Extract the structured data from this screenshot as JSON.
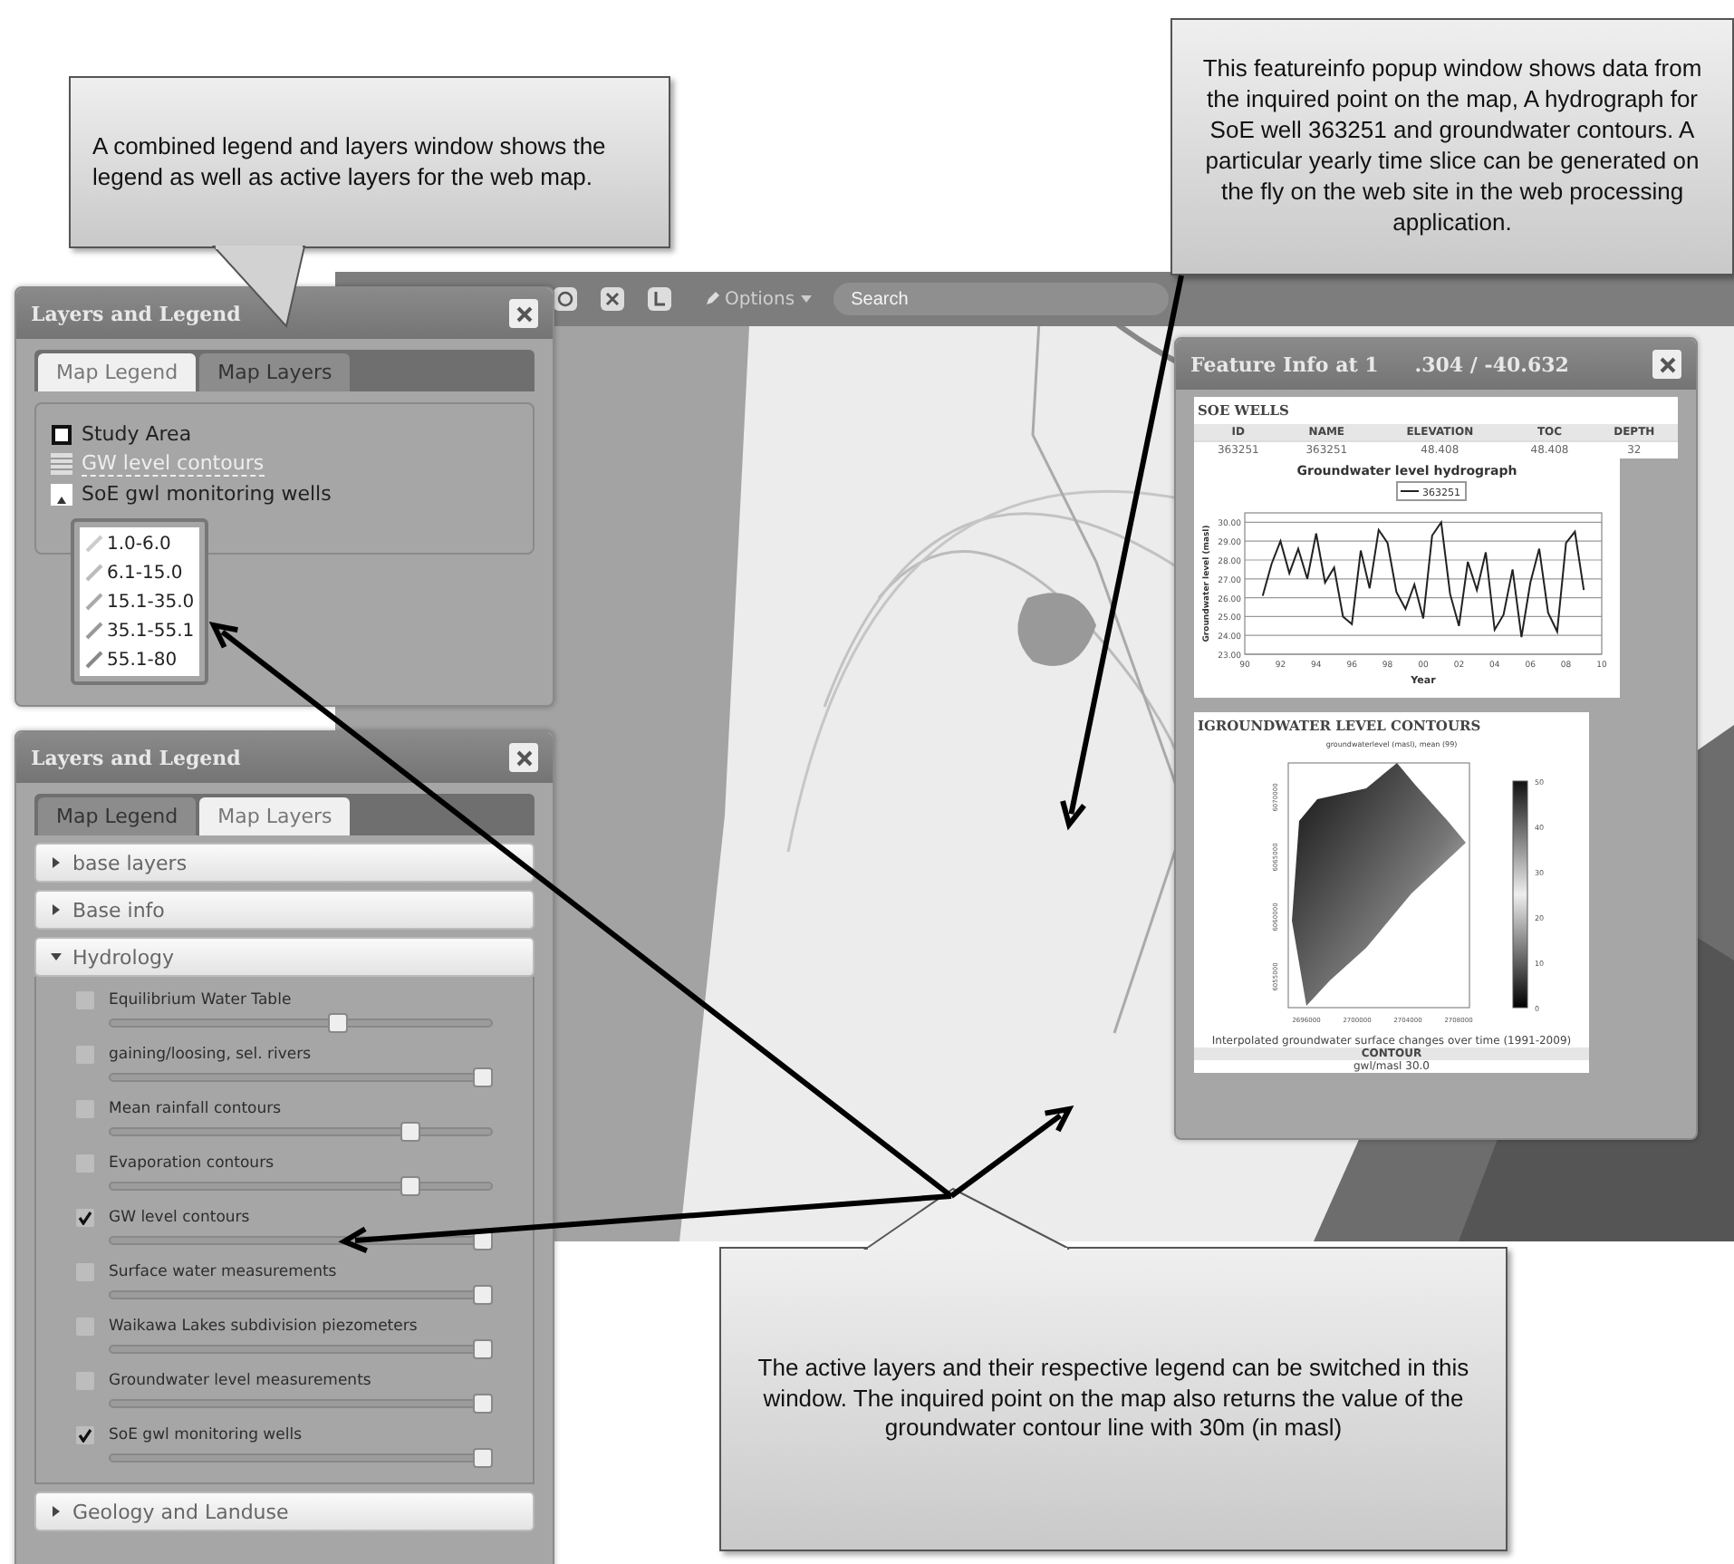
{
  "callouts": [
    {
      "text": "A combined legend and layers window shows the legend as well as active layers for the web map."
    },
    {
      "text": "This featureinfo popup window shows data from the inquired point on the map, A hydrograph for SoE well 363251 and groundwater  contours. A particular yearly time slice  can be generated on the fly on the web site in the web processing application."
    },
    {
      "text": "The active layers and their respective legend can be switched in this window. The inquired point on the map also returns the value of the groundwater contour line with 30m (in masl)"
    }
  ],
  "toolbar": {
    "options": "Options",
    "search": {
      "placeholder": "Search"
    }
  },
  "legend_window": {
    "title": "Layers and Legend",
    "tabs": [
      {
        "label": "Map Legend",
        "selected": true
      },
      {
        "label": "Map Layers",
        "selected": false
      }
    ],
    "items": [
      {
        "kind": "area",
        "label": "Study Area"
      },
      {
        "kind": "link",
        "label": "GW level contours"
      },
      {
        "kind": "point",
        "label": "SoE gwl monitoring wells"
      }
    ],
    "classes": [
      "1.0-6.0",
      "6.1-15.0",
      "15.1-35.0",
      "35.1-55.1",
      "55.1-80"
    ]
  },
  "layers_window": {
    "title": "Layers and Legend",
    "tabs": [
      {
        "label": "Map Legend",
        "selected": false
      },
      {
        "label": "Map Layers",
        "selected": true
      }
    ],
    "groups": [
      {
        "label": "base layers",
        "expanded": false
      },
      {
        "label": "Base info",
        "expanded": false
      },
      {
        "label": "Hydrology",
        "expanded": true,
        "layers": [
          {
            "name": "Equilibrium Water Table",
            "checked": false,
            "level": 0.6
          },
          {
            "name": "gaining/loosing, sel. rivers",
            "checked": false,
            "level": 1
          },
          {
            "name": "Mean rainfall contours",
            "checked": false,
            "level": 0.8
          },
          {
            "name": "Evaporation contours",
            "checked": false,
            "level": 0.8
          },
          {
            "name": "GW level contours",
            "checked": true,
            "level": 1
          },
          {
            "name": "Surface water measurements",
            "checked": false,
            "level": 1
          },
          {
            "name": "Waikawa Lakes subdivision piezometers",
            "checked": false,
            "level": 1
          },
          {
            "name": "Groundwater level measurements",
            "checked": false,
            "level": 1
          },
          {
            "name": "SoE gwl monitoring wells",
            "checked": true,
            "level": 1
          }
        ]
      },
      {
        "label": "Geology and Landuse",
        "expanded": false
      }
    ]
  },
  "feature_window": {
    "title_start": "Feature Info at 1",
    "title_end": ".304 / -40.632",
    "wells": {
      "heading": "SOE WELLS",
      "columns": [
        "ID",
        "NAME",
        "ELEVATION",
        "TOC",
        "DEPTH"
      ],
      "rows": [
        [
          "363251",
          "363251",
          "48.408",
          "48.408",
          "32"
        ]
      ]
    },
    "hydrograph": {
      "chart_data": {
        "type": "line",
        "title": "Groundwater level hydrograph",
        "xlabel": "Year",
        "ylabel": "Groundwater level (masl)",
        "x": [
          1991,
          1991.5,
          1992,
          1992.5,
          1993,
          1993.5,
          1994,
          1994.5,
          1995,
          1995.5,
          1996,
          1996.5,
          1997,
          1997.5,
          1998,
          1998.5,
          1999,
          1999.5,
          2000,
          2000.5,
          2001,
          2001.5,
          2002,
          2002.5,
          2003,
          2003.5,
          2004,
          2004.5,
          2005,
          2005.5,
          2006,
          2006.5,
          2007,
          2007.5,
          2008,
          2008.5,
          2009
        ],
        "series": [
          {
            "name": "363251",
            "color": "#222222",
            "values": [
              26.1,
              27.8,
              29.0,
              27.3,
              28.6,
              27.0,
              29.4,
              26.8,
              27.6,
              25.0,
              24.6,
              28.5,
              26.5,
              29.6,
              28.9,
              26.3,
              25.4,
              26.7,
              24.9,
              29.3,
              30.0,
              26.2,
              24.5,
              27.9,
              26.4,
              28.4,
              24.3,
              25.1,
              27.5,
              23.9,
              26.8,
              28.6,
              25.2,
              24.2,
              28.9,
              29.5,
              26.4
            ]
          }
        ],
        "xlim": [
          1990,
          2010
        ],
        "ylim": [
          23,
          30.5
        ],
        "grid": true,
        "xticks": [
          {
            "value": 1990,
            "label": "90"
          },
          {
            "value": 1992,
            "label": "92"
          },
          {
            "value": 1994,
            "label": "94"
          },
          {
            "value": 1996,
            "label": "96"
          },
          {
            "value": 1998,
            "label": "98"
          },
          {
            "value": 2000,
            "label": "00"
          },
          {
            "value": 2002,
            "label": "02"
          },
          {
            "value": 2004,
            "label": "04"
          },
          {
            "value": 2006,
            "label": "06"
          },
          {
            "value": 2008,
            "label": "08"
          },
          {
            "value": 2010,
            "label": "10"
          }
        ],
        "yticks": [
          {
            "value": 23,
            "label": "23.00"
          },
          {
            "value": 24,
            "label": "24.00"
          },
          {
            "value": 25,
            "label": "25.00"
          },
          {
            "value": 26,
            "label": "26.00"
          },
          {
            "value": 27,
            "label": "27.00"
          },
          {
            "value": 28,
            "label": "28.00"
          },
          {
            "value": 29,
            "label": "29.00"
          },
          {
            "value": 30,
            "label": "30.00"
          }
        ]
      }
    },
    "contours": {
      "heading": "IGROUNDWATER LEVEL CONTOURS",
      "subtitle": "groundwaterlevel (masl), mean (99)",
      "xlabels": [
        "2696000",
        "2700000",
        "2704000",
        "2708000"
      ],
      "ylabels": [
        "6055000",
        "6060000",
        "6065000",
        "6070000"
      ],
      "scale": [
        "50",
        "40",
        "30",
        "20",
        "10",
        "0"
      ],
      "caption": "Interpolated groundwater surface changes over time (1991-2009)",
      "column": "CONTOUR",
      "value": "gwl/masl 30.0"
    }
  }
}
